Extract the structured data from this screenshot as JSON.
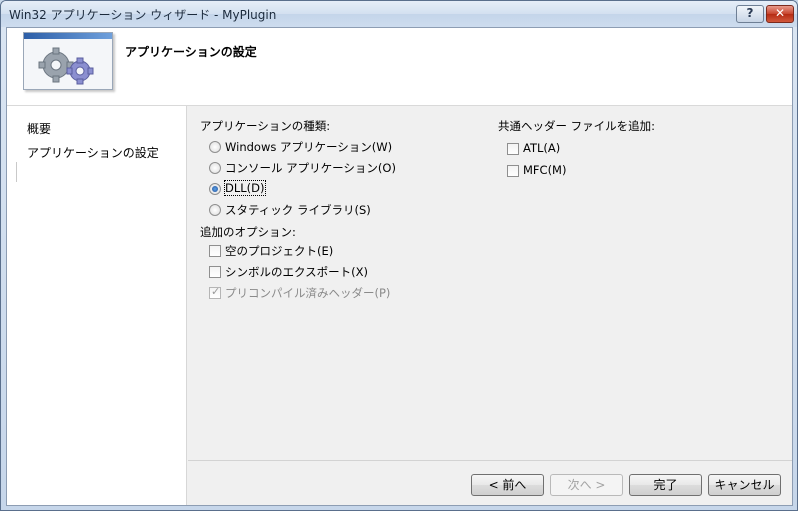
{
  "window": {
    "title": "Win32 アプリケーション ウィザード - MyPlugin",
    "help_label": "?",
    "close_label": "✕"
  },
  "header": {
    "title": "アプリケーションの設定",
    "image_icon": "gears-icon"
  },
  "sidebar": {
    "items": [
      {
        "label": "概要"
      },
      {
        "label": "アプリケーションの設定"
      }
    ]
  },
  "app_type": {
    "label": "アプリケーションの種類:",
    "options": [
      {
        "label": "Windows アプリケーション(W)",
        "selected": false
      },
      {
        "label": "コンソール アプリケーション(O)",
        "selected": false
      },
      {
        "label": "DLL(D)",
        "selected": true
      },
      {
        "label": "スタティック ライブラリ(S)",
        "selected": false
      }
    ]
  },
  "additional_options": {
    "label": "追加のオプション:",
    "options": [
      {
        "label": "空のプロジェクト(E)",
        "checked": false,
        "enabled": true
      },
      {
        "label": "シンボルのエクスポート(X)",
        "checked": false,
        "enabled": true
      },
      {
        "label": "プリコンパイル済みヘッダー(P)",
        "checked": true,
        "enabled": false
      }
    ]
  },
  "common_headers": {
    "label": "共通ヘッダー ファイルを追加:",
    "options": [
      {
        "label": "ATL(A)",
        "checked": false
      },
      {
        "label": "MFC(M)",
        "checked": false
      }
    ]
  },
  "buttons": {
    "prev": "< 前へ",
    "next": "次へ >",
    "finish": "完了",
    "cancel": "キャンセル"
  }
}
